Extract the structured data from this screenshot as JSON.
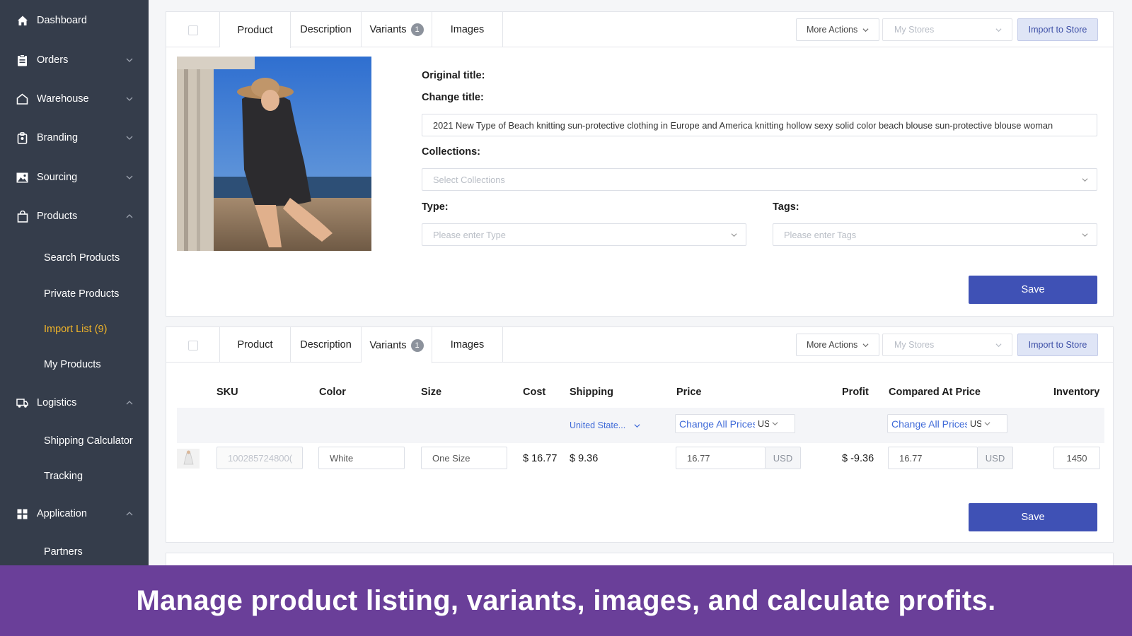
{
  "sidebar": {
    "items": [
      {
        "label": "Dashboard",
        "icon": "home-icon"
      },
      {
        "label": "Orders",
        "icon": "clipboard-icon"
      },
      {
        "label": "Warehouse",
        "icon": "warehouse-icon"
      },
      {
        "label": "Branding",
        "icon": "badge-icon"
      },
      {
        "label": "Sourcing",
        "icon": "image-icon"
      },
      {
        "label": "Products",
        "icon": "shopping-bag-icon"
      },
      {
        "label": "Logistics",
        "icon": "truck-icon"
      },
      {
        "label": "Application",
        "icon": "grid-icon"
      }
    ],
    "products_sub": [
      "Search Products",
      "Private Products",
      "Import List (9)",
      "My Products"
    ],
    "logistics_sub": [
      "Shipping Calculator",
      "Tracking"
    ],
    "application_sub": [
      "Partners"
    ],
    "active_color": "#f0b429"
  },
  "tabs": {
    "product": "Product",
    "description": "Description",
    "variants": "Variants",
    "variants_count": "1",
    "images": "Images"
  },
  "toolbar": {
    "more_actions": "More Actions",
    "my_stores_placeholder": "My Stores",
    "import_to_store": "Import to Store"
  },
  "product_form": {
    "original_title_label": "Original title:",
    "change_title_label": "Change title:",
    "title_value": "2021 New Type of Beach knitting sun-protective clothing in Europe and America knitting hollow sexy solid color beach blouse sun-protective blouse woman",
    "collections_label": "Collections:",
    "collections_placeholder": "Select Collections",
    "type_label": "Type:",
    "type_placeholder": "Please enter Type",
    "tags_label": "Tags:",
    "tags_placeholder": "Please enter Tags",
    "save": "Save"
  },
  "variants_table": {
    "headers": [
      "SKU",
      "Color",
      "Size",
      "Cost",
      "Shipping",
      "Price",
      "Profit",
      "Compared At Price",
      "Inventory"
    ],
    "ship_to": "United State...",
    "change_all_prices": "Change All Prices",
    "currency_short": "US",
    "row": {
      "sku": "100285724800(",
      "color": "White",
      "size": "One Size",
      "cost": "$ 16.77",
      "shipping": "$ 9.36",
      "price": "16.77",
      "price_currency": "USD",
      "profit": "$ -9.36",
      "compared_price": "16.77",
      "compared_currency": "USD",
      "inventory": "1450"
    },
    "save": "Save"
  },
  "caption": "Manage product listing, variants, images, and calculate profits.",
  "colors": {
    "sidebar_bg": "#353d4b",
    "primary": "#3f51b5",
    "caption_bg": "#6a3f99",
    "link": "#3f6ad8"
  }
}
